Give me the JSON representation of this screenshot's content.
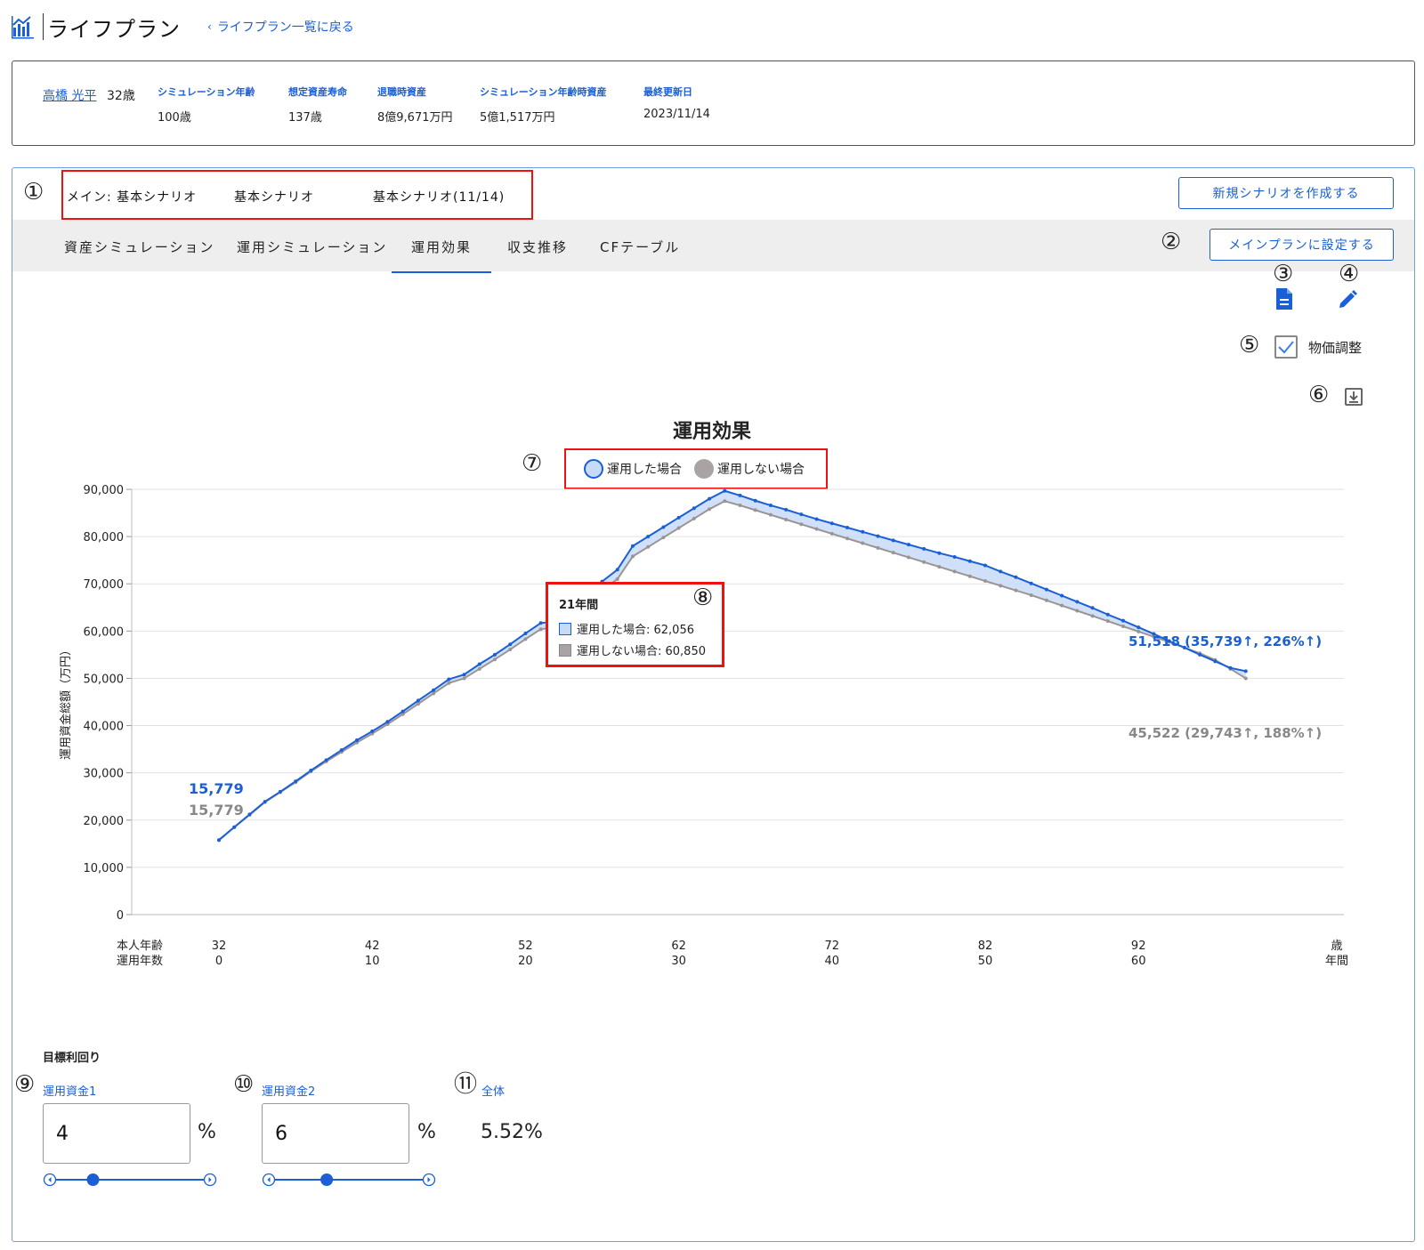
{
  "header": {
    "title": "ライフプラン",
    "back_link": "ライフプラン一覧に戻る"
  },
  "profile": {
    "name": "高橋 光平",
    "age": "32歳",
    "fields": [
      {
        "label": "シミュレーション年齢",
        "value": "100歳"
      },
      {
        "label": "想定資産寿命",
        "value": "137歳"
      },
      {
        "label": "退職時資産",
        "value": "8億9,671万円"
      },
      {
        "label": "シミュレーション年齢時資産",
        "value": "5億1,517万円"
      },
      {
        "label": "最終更新日",
        "value": "2023/11/14"
      }
    ]
  },
  "annotations": [
    "①",
    "②",
    "③",
    "④",
    "⑤",
    "⑥",
    "⑦",
    "⑧",
    "⑨",
    "⑩",
    "⑪"
  ],
  "scenarios": [
    "メイン: 基本シナリオ",
    "基本シナリオ",
    "基本シナリオ(11/14)"
  ],
  "buttons": {
    "new_scenario": "新規シナリオを作成する",
    "set_main": "メインプランに設定する"
  },
  "tabs": [
    {
      "label": "資産シミュレーション",
      "active": false
    },
    {
      "label": "運用シミュレーション",
      "active": false
    },
    {
      "label": "運用効果",
      "active": true
    },
    {
      "label": "収支推移",
      "active": false
    },
    {
      "label": "CFテーブル",
      "active": false
    }
  ],
  "icons": {
    "document": "document-icon",
    "edit": "pencil-icon",
    "download": "download-icon"
  },
  "inflation": {
    "label": "物価調整",
    "checked": true
  },
  "colors": {
    "accent": "#1a5fd6",
    "invested": "#1a5fd6",
    "not_invested": "#9a9494",
    "fill": "#c7dbf7",
    "highlight": "#e11111"
  },
  "chart_data": {
    "type": "area",
    "title": "運用効果",
    "ylabel": "運用資金総額（万円）",
    "xlabel_rows": [
      "本人年齢",
      "運用年数"
    ],
    "x_unit_rows": [
      "歳",
      "年間"
    ],
    "ylim": [
      0,
      90000
    ],
    "yticks": [
      "0",
      "10,000",
      "20,000",
      "30,000",
      "40,000",
      "50,000",
      "60,000",
      "70,000",
      "80,000",
      "90,000"
    ],
    "xlim": [
      32,
      100
    ],
    "xticks": [
      {
        "age": "32",
        "years": "0"
      },
      {
        "age": "42",
        "years": "10"
      },
      {
        "age": "52",
        "years": "20"
      },
      {
        "age": "62",
        "years": "30"
      },
      {
        "age": "72",
        "years": "40"
      },
      {
        "age": "82",
        "years": "50"
      },
      {
        "age": "92",
        "years": "60"
      }
    ],
    "grid": true,
    "legend_position": "top-center",
    "x": [
      32,
      33,
      34,
      35,
      36,
      37,
      38,
      39,
      40,
      41,
      42,
      43,
      44,
      45,
      46,
      47,
      48,
      49,
      50,
      51,
      52,
      53,
      54,
      55,
      56,
      57,
      58,
      59,
      60,
      61,
      62,
      63,
      64,
      65,
      66,
      67,
      68,
      69,
      70,
      71,
      72,
      73,
      74,
      75,
      76,
      77,
      78,
      79,
      80,
      81,
      82,
      83,
      84,
      85,
      86,
      87,
      88,
      89,
      90,
      91,
      92,
      93,
      94,
      95,
      96,
      97,
      98,
      99,
      100
    ],
    "series": [
      {
        "name": "運用した場合",
        "values": [
          15779,
          18500,
          21200,
          23900,
          26000,
          28200,
          30500,
          32700,
          34800,
          36900,
          38800,
          40800,
          43000,
          45300,
          47500,
          49800,
          50800,
          53000,
          55000,
          57200,
          59500,
          61700,
          62056,
          64800,
          67200,
          70500,
          73000,
          78000,
          80000,
          82000,
          84000,
          86000,
          88000,
          89671,
          88700,
          87600,
          86600,
          85700,
          84700,
          83700,
          82800,
          81900,
          81000,
          80100,
          79200,
          78300,
          77400,
          76500,
          75700,
          74800,
          73900,
          72600,
          71400,
          70100,
          68800,
          67500,
          66200,
          64900,
          63500,
          62200,
          60800,
          59400,
          57900,
          56500,
          55000,
          53600,
          52200,
          51518
        ]
      },
      {
        "name": "運用しない場合",
        "values": [
          15779,
          18500,
          21100,
          23800,
          25900,
          28000,
          30300,
          32400,
          34400,
          36400,
          38300,
          40300,
          42400,
          44600,
          46800,
          49000,
          50000,
          52000,
          54000,
          56100,
          58300,
          60400,
          60850,
          63300,
          65600,
          68700,
          71000,
          75800,
          77800,
          79800,
          81800,
          83800,
          85800,
          87500,
          86600,
          85600,
          84600,
          83600,
          82600,
          81600,
          80600,
          79600,
          78600,
          77600,
          76600,
          75600,
          74600,
          73600,
          72600,
          71600,
          70600,
          69600,
          68600,
          67600,
          66500,
          65400,
          64300,
          63200,
          62100,
          61000,
          59900,
          58800,
          57700,
          56500,
          55300,
          53900,
          52000,
          50000,
          48000,
          45522
        ]
      }
    ],
    "start_labels": [
      "15,779",
      "15,779"
    ],
    "end_labels": [
      "51,518 (35,739↑, 226%↑)",
      "45,522 (29,743↑, 188%↑)"
    ],
    "tooltip": {
      "title": "21年間",
      "rows": [
        {
          "label": "運用した場合: 62,056"
        },
        {
          "label": "運用しない場合: 60,850"
        }
      ]
    }
  },
  "targets": {
    "title": "目標利回り",
    "fund1": {
      "label": "運用資金1",
      "value": "4",
      "unit": "%",
      "slider": 0.25
    },
    "fund2": {
      "label": "運用資金2",
      "value": "6",
      "unit": "%",
      "slider": 0.35
    },
    "total": {
      "label": "全体",
      "value": "5.52%"
    }
  }
}
